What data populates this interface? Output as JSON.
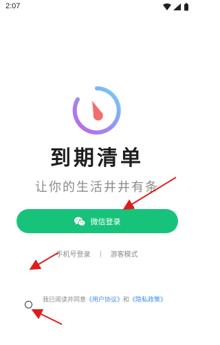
{
  "status_bar": {
    "time": "2:07",
    "icons": [
      "wifi-icon",
      "signal-icon",
      "battery-icon"
    ]
  },
  "app": {
    "title": "到期清单",
    "slogan": "让你的生活井井有条"
  },
  "login": {
    "wechat_label": "微信登录",
    "phone_label": "手机号登录",
    "guest_label": "游客模式"
  },
  "agreement": {
    "prefix": "我已阅读并同意",
    "user_agreement": "《用户协议》",
    "conjunction": "和",
    "privacy_policy": "《隐私政策》"
  },
  "colors": {
    "accent": "#17c37b",
    "link": "#3a8ee6",
    "annotation": "#e01b1b",
    "logo_gradient_start": "#6fd3f2",
    "logo_gradient_end": "#c064e6",
    "logo_needle": "#f26d6d"
  }
}
